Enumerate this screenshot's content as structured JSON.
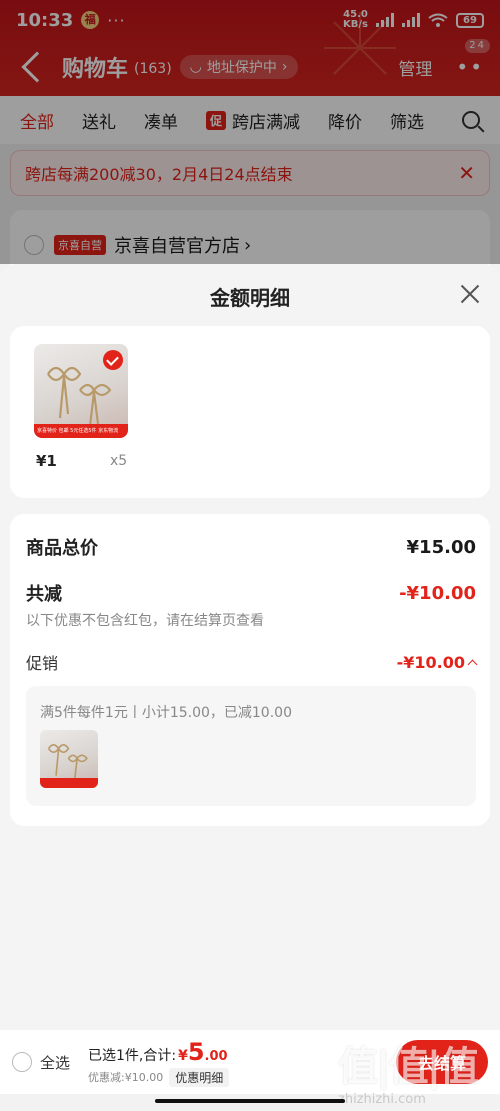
{
  "status": {
    "time": "10:33",
    "net_speed_value": "45.0",
    "net_speed_unit": "KB/s",
    "battery": "69"
  },
  "header": {
    "title": "购物车",
    "count": "(163)",
    "address_protect": "地址保护中",
    "manage": "管理",
    "more_badge": "24"
  },
  "tabs": [
    {
      "label": "全部"
    },
    {
      "label": "送礼"
    },
    {
      "label": "凑单"
    },
    {
      "label": "跨店满减",
      "tag": "促"
    },
    {
      "label": "降价"
    },
    {
      "label": "筛选"
    }
  ],
  "notice": {
    "text": "跨店每满200减30，2月4日24点结束",
    "close": "✕"
  },
  "store": {
    "tag": "京喜自营",
    "name": "京喜自营官方店"
  },
  "sheet": {
    "title": "金额明细",
    "goods": {
      "price": "¥1",
      "qty": "x5",
      "thumb_strip": "京喜特价 包邮 5元任选5件 京东物流"
    },
    "total_label": "商品总价",
    "total_value": "¥15.00",
    "reduce_label": "共减",
    "reduce_value": "-¥10.00",
    "hint": "以下优惠不包含红包，请在结算页查看",
    "promo_label": "促销",
    "promo_value": "-¥10.00",
    "promo_desc": "满5件每件1元丨小计15.00，已减10.00"
  },
  "checkout": {
    "select_all": "全选",
    "selected_text": "已选1件,合计:",
    "yen": "¥",
    "amount_int": "5",
    "amount_dec": ".00",
    "discount_text": "优惠减:¥10.00",
    "detail_button": "优惠明细",
    "settle_button": "去结算"
  },
  "watermark": {
    "logo": "值|值|值",
    "url": "zhizhizhi.com"
  },
  "colors": {
    "brand_red": "#e2231a",
    "header_red": "#c4141a"
  }
}
